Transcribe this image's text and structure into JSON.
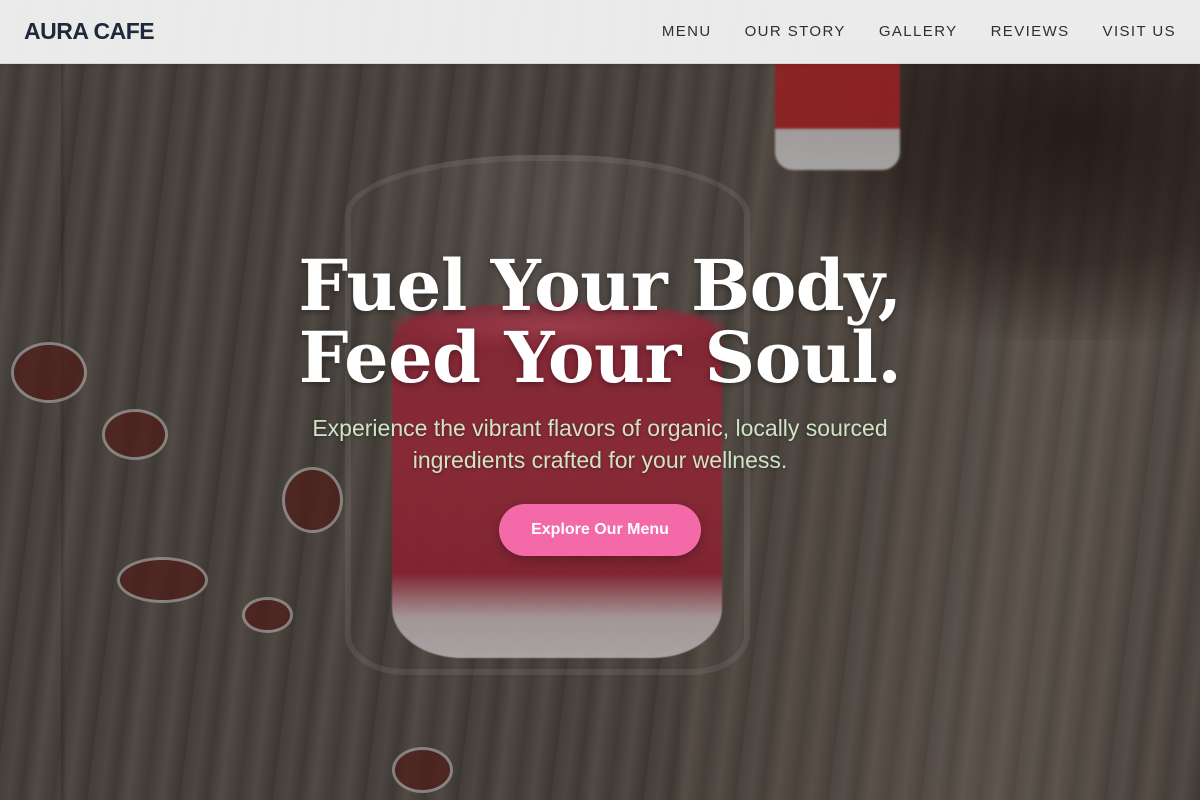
{
  "brand": {
    "name": "AURA CAFE"
  },
  "nav": {
    "items": [
      {
        "label": "MENU"
      },
      {
        "label": "OUR STORY"
      },
      {
        "label": "GALLERY"
      },
      {
        "label": "REVIEWS"
      },
      {
        "label": "VISIT US"
      }
    ]
  },
  "hero": {
    "title_line1": "Fuel Your Body,",
    "title_line2": "Feed Your Soul.",
    "subtitle": "Experience the vibrant flavors of organic, locally sourced ingredients crafted for your wellness.",
    "cta_label": "Explore Our Menu"
  },
  "colors": {
    "header_bg": "#f5f5f5",
    "brand_text": "#1e293b",
    "subtitle_text": "#cfe3c5",
    "cta_bg": "#f46aa8",
    "juice_red": "#c13a4c"
  }
}
